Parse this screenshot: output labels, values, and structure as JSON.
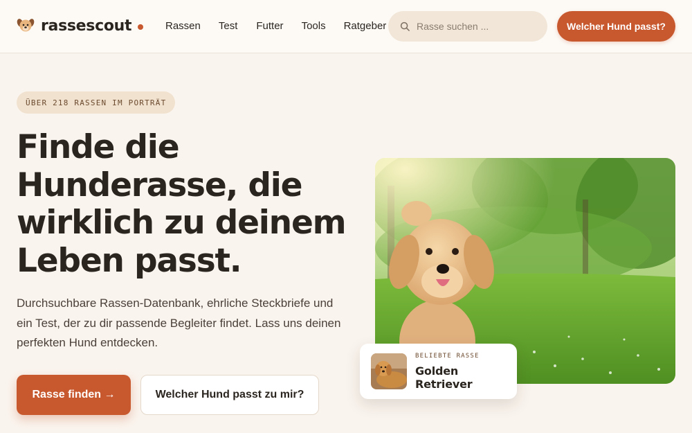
{
  "header": {
    "logo_text": "rassescout",
    "nav": [
      "Rassen",
      "Test",
      "Futter",
      "Tools",
      "Ratgeber"
    ],
    "search_placeholder": "Rasse suchen ...",
    "cta_label": "Welcher Hund passt?"
  },
  "hero": {
    "badge": "ÜBER 218 RASSEN IM PORTRÄT",
    "headline": "Finde die Hunderasse, die wirklich zu deinem Leben passt.",
    "subtext": "Durchsuchbare Rassen-Datenbank, ehrliche Steckbriefe und ein Test, der zu dir passende Begleiter findet. Lass uns deinen perfekten Hund entdecken.",
    "primary_button": "Rasse finden →",
    "secondary_button": "Welcher Hund passt zu mir?"
  },
  "featured": {
    "label": "BELIEBTE RASSE",
    "name": "Golden Retriever"
  },
  "colors": {
    "accent": "#c8582e",
    "background": "#faf4ee",
    "text": "#2b2520"
  }
}
